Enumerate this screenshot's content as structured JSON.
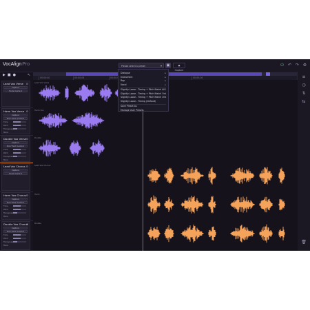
{
  "app": {
    "name": "VocAlign",
    "edition": "Pro"
  },
  "toolbar": {
    "preset_placeholder": "Please select a preset",
    "save_icon": "save-icon",
    "capture_label": "● Capture",
    "icons": [
      "power-icon",
      "undo-icon",
      "redo-icon",
      "settings-icon"
    ]
  },
  "transport": {
    "play": "▶",
    "stop": "■",
    "record": "●",
    "cursor": "↖"
  },
  "ruler": {
    "ticks": [
      "00:00:00",
      "00:00:04",
      "00:00:08",
      "00:00:12",
      "00:00:16"
    ]
  },
  "preset_menu": {
    "items": [
      {
        "label": "Dialogue",
        "submenu": true
      },
      {
        "label": "Instrument",
        "submenu": true
      },
      {
        "label": "Rap",
        "submenu": true
      },
      {
        "label": "Vocal",
        "submenu": true
      },
      {
        "label": "Slightly Loose - Timing + Pitch Match All Notes",
        "submenu": false
      },
      {
        "label": "Slightly Loose - Timing + Pitch Match Only Unison",
        "submenu": false
      },
      {
        "label": "Slightly Loose - Timing + Pitch Match Unison, Tune Harmony",
        "submenu": false
      },
      {
        "label": "Slightly Loose - Timing (Default)",
        "submenu": false
      },
      {
        "label": "Save Preset As",
        "submenu": false
      },
      {
        "label": "Manage User Presets",
        "submenu": false
      }
    ]
  },
  "tracks": [
    {
      "name": "Lead Vox Verse",
      "mode": "Capture",
      "scale": "Scale Guide  ▾",
      "role": "guide",
      "color": "#9a7cf0",
      "label": "Lead Vox Verse"
    },
    {
      "name": "Harm Vox Verse",
      "mode": "Capture",
      "scale": "Dub Track Guide  ▾",
      "role": "dub",
      "color": "#9a7cf0",
      "label": "Harm Vox"
    },
    {
      "name": "Double Vox Verse",
      "mode": "Capture",
      "scale": "Dub Track Guide  ▾",
      "role": "dub",
      "color": "#9a7cf0",
      "label": "Double"
    },
    {
      "name": "Lead Vox Chorus",
      "mode": "Capture",
      "scale": "Scale Guide  ▾",
      "role": "guide",
      "color": "#f5a25a",
      "label": "Lead Vox Chorus"
    },
    {
      "name": "Harm Vox Chorus",
      "mode": "Capture",
      "scale": "Dub Track Guide  ▾",
      "role": "dub",
      "color": "#f5a25a",
      "label": "Harm"
    },
    {
      "name": "Double Vox Chorus",
      "mode": "Capture",
      "scale": "Dub Track Guide  ▾",
      "role": "dub",
      "color": "#f5a25a",
      "label": "Double"
    }
  ],
  "params": {
    "timing": "Time",
    "pitch": "Pitch",
    "transpose": "Transpose",
    "more": "More"
  },
  "colors": {
    "accent_purple": "#9a7cf0",
    "accent_orange": "#f5a25a",
    "background": "#15121c",
    "power_green": "#36c06a"
  }
}
